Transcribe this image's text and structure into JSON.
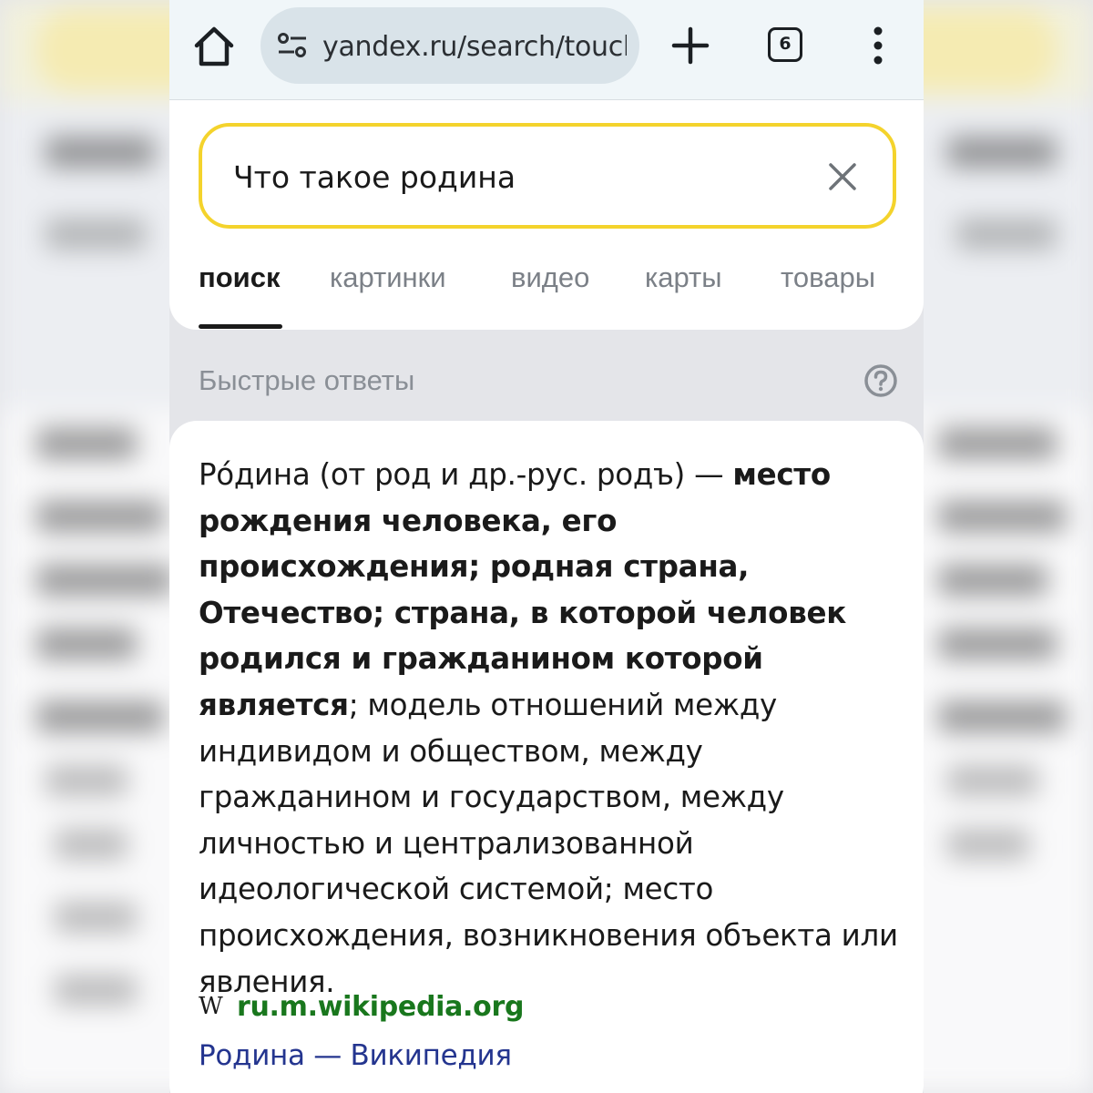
{
  "browser": {
    "url": "yandex.ru/search/touch",
    "tab_count": "6"
  },
  "search": {
    "query": "Что такое родина"
  },
  "nav_tabs": [
    {
      "label": "поиск",
      "active": true
    },
    {
      "label": "картинки",
      "active": false
    },
    {
      "label": "видео",
      "active": false
    },
    {
      "label": "карты",
      "active": false
    },
    {
      "label": "товары",
      "active": false
    }
  ],
  "quick_answers": {
    "title": "Быстрые ответы",
    "segments": [
      {
        "text": "Ро́дина (от род и др.-рус. родъ) — ",
        "bold": false
      },
      {
        "text": "место рождения человека, его происхождения; родная страна, Отечество; страна, в которой человек родился и гражданином которой является",
        "bold": true
      },
      {
        "text": "; модель отношений между индивидом и обществом, между гражданином и государством, между личностью и централизованной идеологической системой; место происхождения, возникновения объекта или явления.",
        "bold": false
      }
    ],
    "source_domain": "ru.m.wikipedia.org",
    "source_title": "Родина — Википедия"
  },
  "colors": {
    "accent_yellow": "#f4d32c",
    "link_green": "#19771d",
    "link_blue": "#24358f",
    "muted_gray": "#8a8f96"
  },
  "icons": [
    "home-icon",
    "site-settings-icon",
    "plus-icon",
    "tabs-counter-icon",
    "more-vert-icon",
    "close-icon",
    "help-icon",
    "wikipedia-icon"
  ]
}
